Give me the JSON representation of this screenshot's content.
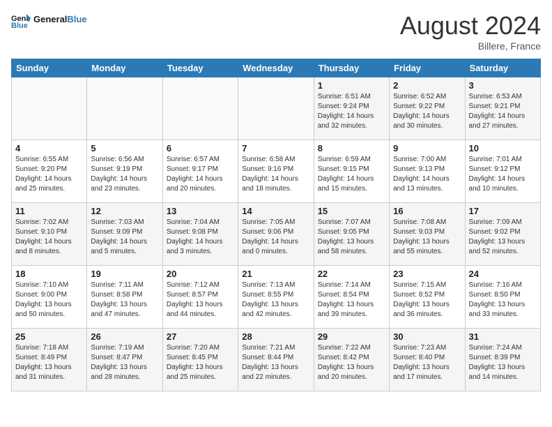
{
  "logo": {
    "text_general": "General",
    "text_blue": "Blue"
  },
  "header": {
    "month_year": "August 2024",
    "location": "Billere, France"
  },
  "days_of_week": [
    "Sunday",
    "Monday",
    "Tuesday",
    "Wednesday",
    "Thursday",
    "Friday",
    "Saturday"
  ],
  "weeks": [
    [
      {
        "day": "",
        "info": ""
      },
      {
        "day": "",
        "info": ""
      },
      {
        "day": "",
        "info": ""
      },
      {
        "day": "",
        "info": ""
      },
      {
        "day": "1",
        "info": "Sunrise: 6:51 AM\nSunset: 9:24 PM\nDaylight: 14 hours\nand 32 minutes."
      },
      {
        "day": "2",
        "info": "Sunrise: 6:52 AM\nSunset: 9:22 PM\nDaylight: 14 hours\nand 30 minutes."
      },
      {
        "day": "3",
        "info": "Sunrise: 6:53 AM\nSunset: 9:21 PM\nDaylight: 14 hours\nand 27 minutes."
      }
    ],
    [
      {
        "day": "4",
        "info": "Sunrise: 6:55 AM\nSunset: 9:20 PM\nDaylight: 14 hours\nand 25 minutes."
      },
      {
        "day": "5",
        "info": "Sunrise: 6:56 AM\nSunset: 9:19 PM\nDaylight: 14 hours\nand 23 minutes."
      },
      {
        "day": "6",
        "info": "Sunrise: 6:57 AM\nSunset: 9:17 PM\nDaylight: 14 hours\nand 20 minutes."
      },
      {
        "day": "7",
        "info": "Sunrise: 6:58 AM\nSunset: 9:16 PM\nDaylight: 14 hours\nand 18 minutes."
      },
      {
        "day": "8",
        "info": "Sunrise: 6:59 AM\nSunset: 9:15 PM\nDaylight: 14 hours\nand 15 minutes."
      },
      {
        "day": "9",
        "info": "Sunrise: 7:00 AM\nSunset: 9:13 PM\nDaylight: 14 hours\nand 13 minutes."
      },
      {
        "day": "10",
        "info": "Sunrise: 7:01 AM\nSunset: 9:12 PM\nDaylight: 14 hours\nand 10 minutes."
      }
    ],
    [
      {
        "day": "11",
        "info": "Sunrise: 7:02 AM\nSunset: 9:10 PM\nDaylight: 14 hours\nand 8 minutes."
      },
      {
        "day": "12",
        "info": "Sunrise: 7:03 AM\nSunset: 9:09 PM\nDaylight: 14 hours\nand 5 minutes."
      },
      {
        "day": "13",
        "info": "Sunrise: 7:04 AM\nSunset: 9:08 PM\nDaylight: 14 hours\nand 3 minutes."
      },
      {
        "day": "14",
        "info": "Sunrise: 7:05 AM\nSunset: 9:06 PM\nDaylight: 14 hours\nand 0 minutes."
      },
      {
        "day": "15",
        "info": "Sunrise: 7:07 AM\nSunset: 9:05 PM\nDaylight: 13 hours\nand 58 minutes."
      },
      {
        "day": "16",
        "info": "Sunrise: 7:08 AM\nSunset: 9:03 PM\nDaylight: 13 hours\nand 55 minutes."
      },
      {
        "day": "17",
        "info": "Sunrise: 7:09 AM\nSunset: 9:02 PM\nDaylight: 13 hours\nand 52 minutes."
      }
    ],
    [
      {
        "day": "18",
        "info": "Sunrise: 7:10 AM\nSunset: 9:00 PM\nDaylight: 13 hours\nand 50 minutes."
      },
      {
        "day": "19",
        "info": "Sunrise: 7:11 AM\nSunset: 8:58 PM\nDaylight: 13 hours\nand 47 minutes."
      },
      {
        "day": "20",
        "info": "Sunrise: 7:12 AM\nSunset: 8:57 PM\nDaylight: 13 hours\nand 44 minutes."
      },
      {
        "day": "21",
        "info": "Sunrise: 7:13 AM\nSunset: 8:55 PM\nDaylight: 13 hours\nand 42 minutes."
      },
      {
        "day": "22",
        "info": "Sunrise: 7:14 AM\nSunset: 8:54 PM\nDaylight: 13 hours\nand 39 minutes."
      },
      {
        "day": "23",
        "info": "Sunrise: 7:15 AM\nSunset: 8:52 PM\nDaylight: 13 hours\nand 36 minutes."
      },
      {
        "day": "24",
        "info": "Sunrise: 7:16 AM\nSunset: 8:50 PM\nDaylight: 13 hours\nand 33 minutes."
      }
    ],
    [
      {
        "day": "25",
        "info": "Sunrise: 7:18 AM\nSunset: 8:49 PM\nDaylight: 13 hours\nand 31 minutes."
      },
      {
        "day": "26",
        "info": "Sunrise: 7:19 AM\nSunset: 8:47 PM\nDaylight: 13 hours\nand 28 minutes."
      },
      {
        "day": "27",
        "info": "Sunrise: 7:20 AM\nSunset: 8:45 PM\nDaylight: 13 hours\nand 25 minutes."
      },
      {
        "day": "28",
        "info": "Sunrise: 7:21 AM\nSunset: 8:44 PM\nDaylight: 13 hours\nand 22 minutes."
      },
      {
        "day": "29",
        "info": "Sunrise: 7:22 AM\nSunset: 8:42 PM\nDaylight: 13 hours\nand 20 minutes."
      },
      {
        "day": "30",
        "info": "Sunrise: 7:23 AM\nSunset: 8:40 PM\nDaylight: 13 hours\nand 17 minutes."
      },
      {
        "day": "31",
        "info": "Sunrise: 7:24 AM\nSunset: 8:39 PM\nDaylight: 13 hours\nand 14 minutes."
      }
    ]
  ]
}
